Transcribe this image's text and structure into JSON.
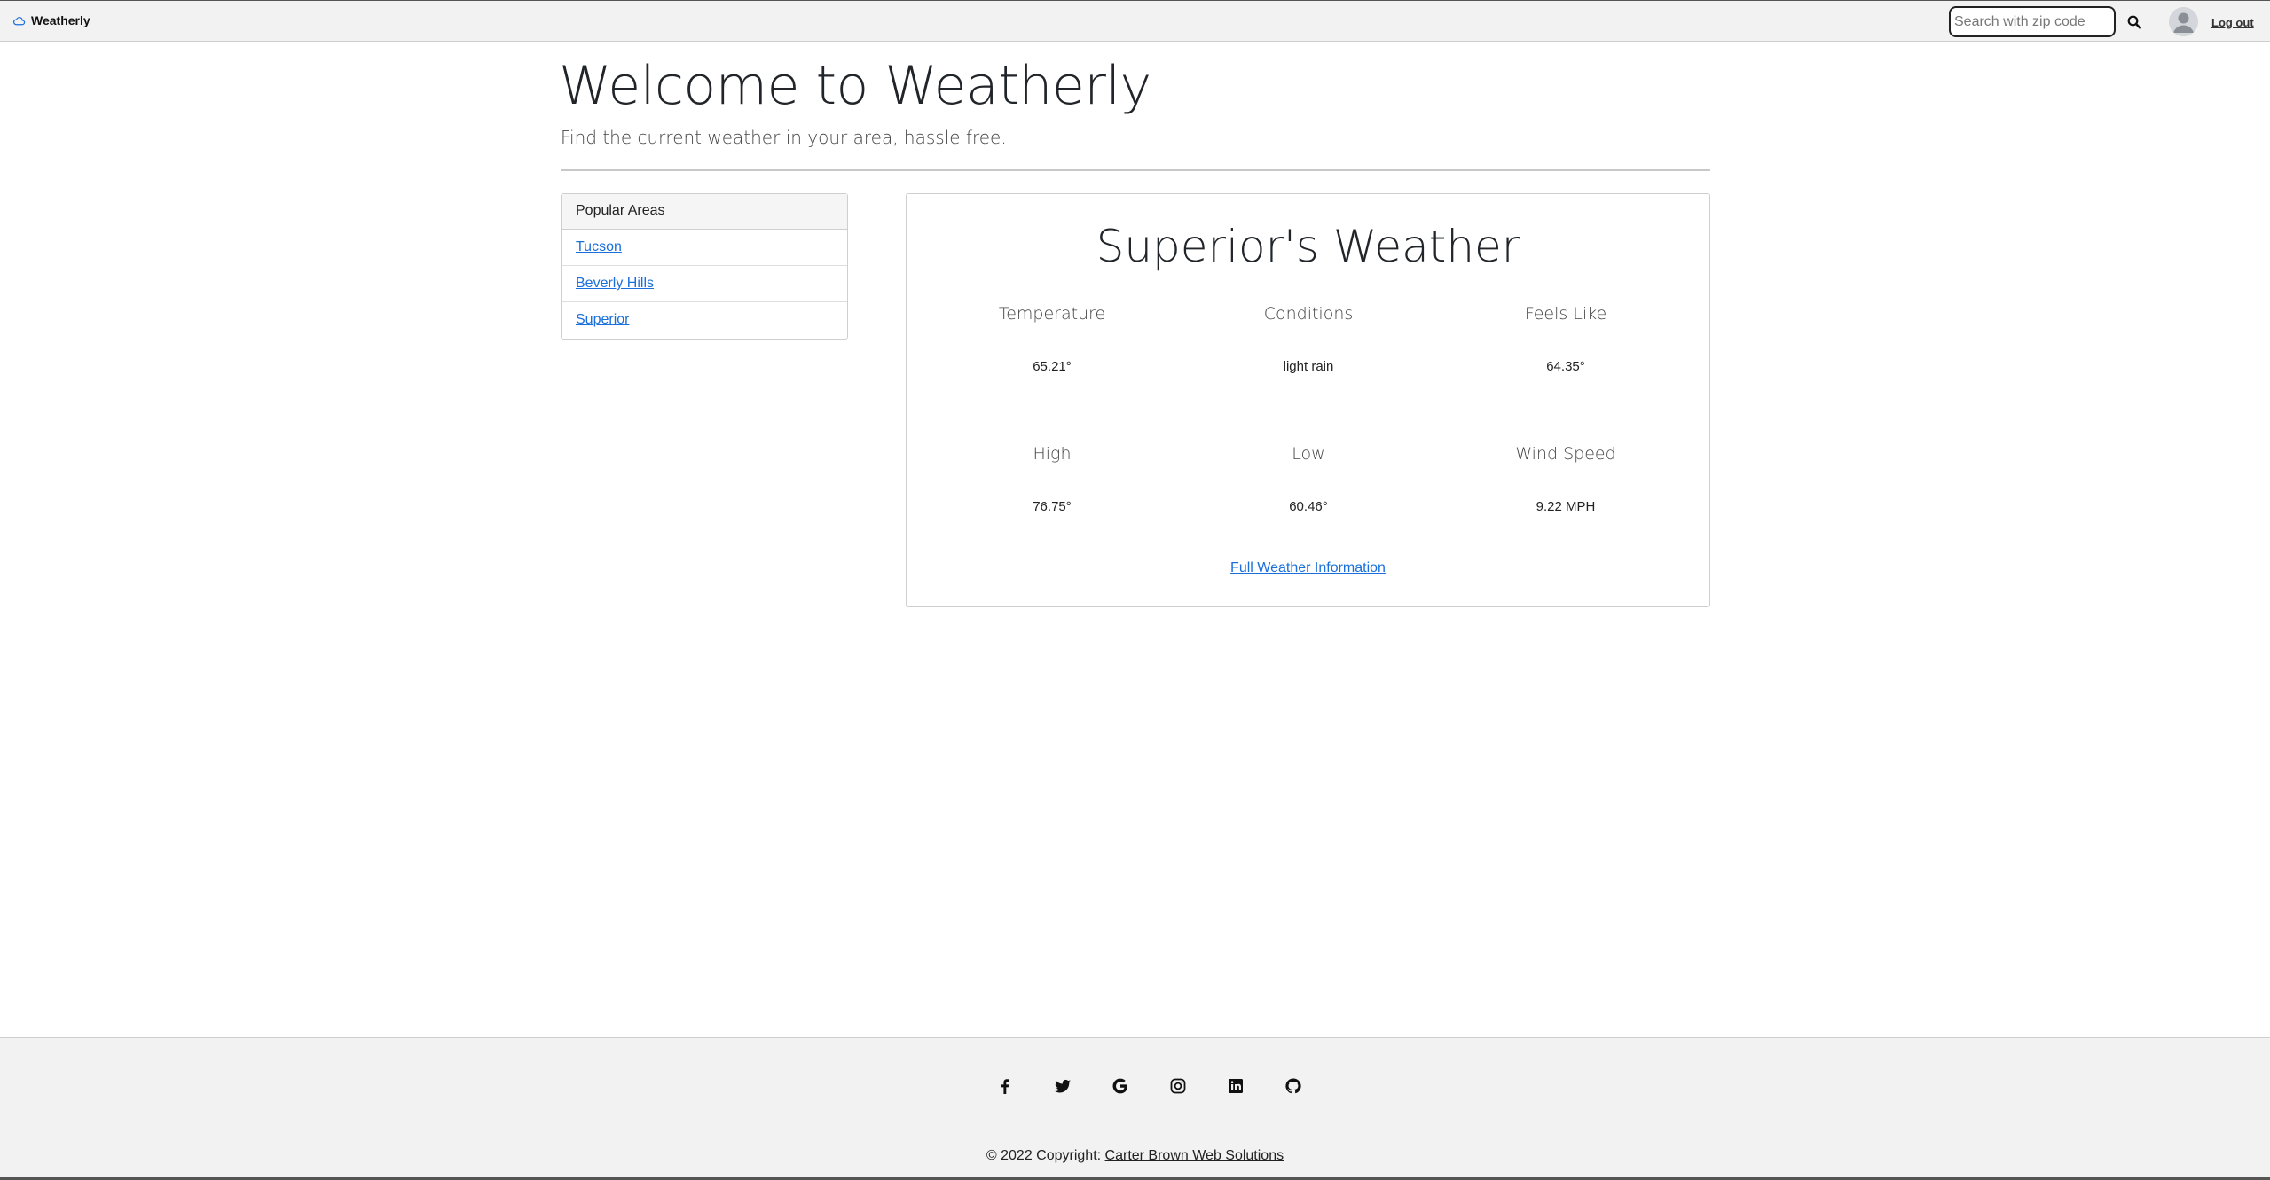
{
  "navbar": {
    "brand": "Weatherly",
    "search_placeholder": "Search with zip code",
    "logout_label": "Log out"
  },
  "header": {
    "title": "Welcome to Weatherly",
    "lead": "Find the current weather in your area, hassle free."
  },
  "popular_areas": {
    "title": "Popular Areas",
    "items": [
      {
        "label": "Tucson"
      },
      {
        "label": "Beverly Hills"
      },
      {
        "label": "Superior"
      }
    ]
  },
  "weather": {
    "title": "Superior's Weather",
    "stats": [
      {
        "label": "Temperature",
        "value": "65.21°"
      },
      {
        "label": "Conditions",
        "value": "light rain"
      },
      {
        "label": "Feels Like",
        "value": "64.35°"
      },
      {
        "label": "High",
        "value": "76.75°"
      },
      {
        "label": "Low",
        "value": "60.46°"
      },
      {
        "label": "Wind Speed",
        "value": "9.22 MPH"
      }
    ],
    "full_link": "Full Weather Information"
  },
  "footer": {
    "social_icons": [
      "facebook-icon",
      "twitter-icon",
      "google-icon",
      "instagram-icon",
      "linkedin-icon",
      "github-icon"
    ],
    "copyright_prefix": "© 2022 Copyright: ",
    "copyright_link": "Carter Brown Web Solutions"
  },
  "colors": {
    "link": "#1a6fdb",
    "navbar_bg": "#f2f2f2",
    "footer_bg": "#f2f2f2"
  }
}
